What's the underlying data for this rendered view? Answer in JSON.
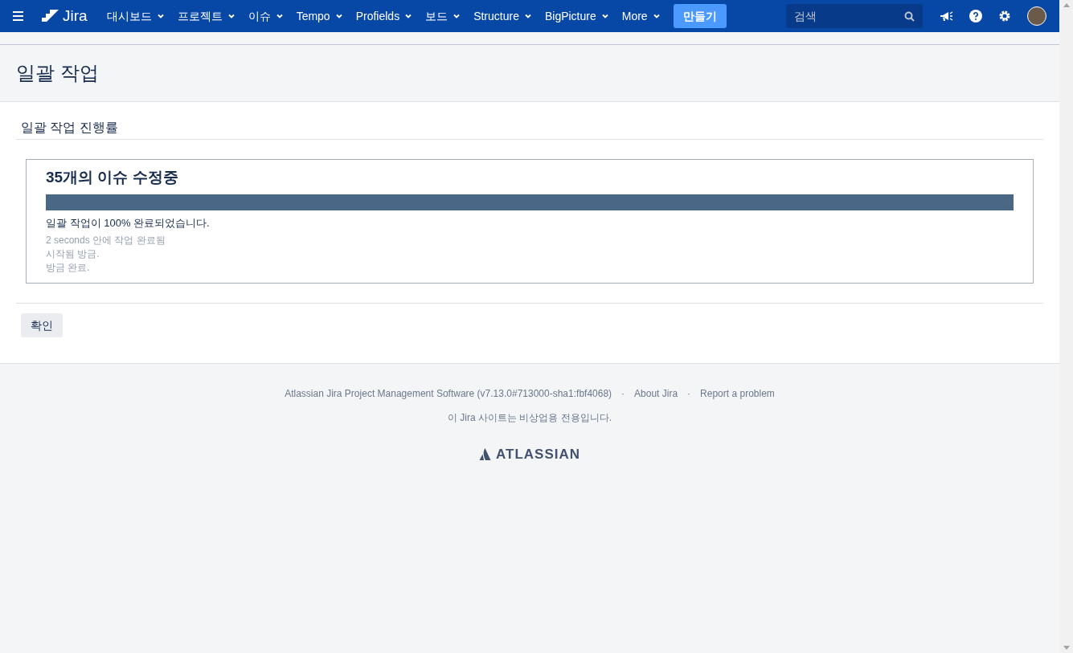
{
  "header": {
    "logo": "Jira",
    "nav": [
      {
        "label": "대시보드"
      },
      {
        "label": "프로젝트"
      },
      {
        "label": "이슈"
      },
      {
        "label": "Tempo"
      },
      {
        "label": "Profields"
      },
      {
        "label": "보드"
      },
      {
        "label": "Structure"
      },
      {
        "label": "BigPicture"
      },
      {
        "label": "More"
      }
    ],
    "create_button": "만들기",
    "search": {
      "placeholder": "검색"
    }
  },
  "page": {
    "title": "일괄 작업"
  },
  "section": {
    "title": "일괄 작업 진행률"
  },
  "progress": {
    "heading": "35개의 이슈 수정중",
    "level": 1,
    "status": "일괄 작업이 100% 완료되었습니다.",
    "details": [
      "2 seconds 안에 작업 완료됨",
      "시작됨 방금.",
      "방금 완료."
    ]
  },
  "actions": {
    "confirm": "확인"
  },
  "footer": {
    "links": [
      "Atlassian Jira Project Management Software (v7.13.0#713000-sha1:fbf4068)",
      "About Jira",
      "Report a problem"
    ],
    "separator": "·",
    "notice": "이 Jira 사이트는 비상업용 전용입니다.",
    "brand": "ATLASSIAN"
  }
}
